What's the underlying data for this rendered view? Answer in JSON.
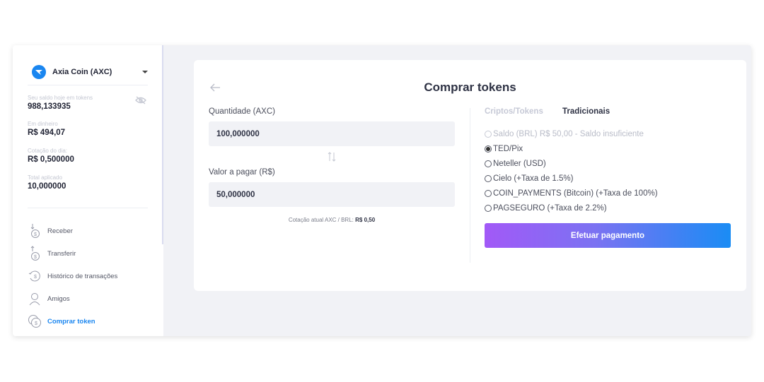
{
  "sidebar": {
    "coin_name": "Axia Coin (AXC)",
    "stats": [
      {
        "label": "Seu saldo hoje em tokens",
        "value": "988,133935"
      },
      {
        "label": "Em dinheiro",
        "value": "R$ 494,07"
      },
      {
        "label": "Cotação do dia:",
        "value": "R$ 0,500000"
      },
      {
        "label": "Total aplicado",
        "value": "10,000000"
      }
    ],
    "nav": [
      {
        "label": "Receber",
        "icon": "receive-icon"
      },
      {
        "label": "Transferir",
        "icon": "transfer-icon"
      },
      {
        "label": "Histórico de transações",
        "icon": "history-icon"
      },
      {
        "label": "Amigos",
        "icon": "friends-icon"
      },
      {
        "label": "Comprar token",
        "icon": "buy-token-icon",
        "active": true
      }
    ]
  },
  "main": {
    "title": "Comprar tokens",
    "quantity_label": "Quantidade (AXC)",
    "quantity_value": "100,000000",
    "amount_label": "Valor a pagar (R$)",
    "amount_value": "50,000000",
    "rate_note_prefix": "Cotação atual AXC / BRL:",
    "rate_note_value": "R$ 0,50",
    "tabs": [
      {
        "label": "Criptos/Tokens",
        "active": false
      },
      {
        "label": "Tradicionais",
        "active": true
      }
    ],
    "payment_options": [
      {
        "label": "Saldo (BRL) R$ 50,00 - Saldo insuficiente",
        "selected": false,
        "disabled": true
      },
      {
        "label": "TED/Pix",
        "selected": true,
        "disabled": false
      },
      {
        "label": "Neteller (USD)",
        "selected": false,
        "disabled": false
      },
      {
        "label": "Cielo (+Taxa de 1.5%)",
        "selected": false,
        "disabled": false
      },
      {
        "label": "COIN_PAYMENTS (Bitcoin) (+Taxa de 100%)",
        "selected": false,
        "disabled": false
      },
      {
        "label": "PAGSEGURO (+Taxa de 2.2%)",
        "selected": false,
        "disabled": false
      }
    ],
    "pay_button_label": "Efetuar pagamento"
  },
  "colors": {
    "accent": "#1a86f0",
    "gradient_start": "#a259f7",
    "gradient_end": "#1a8cf4",
    "background": "#f1f2f6"
  }
}
